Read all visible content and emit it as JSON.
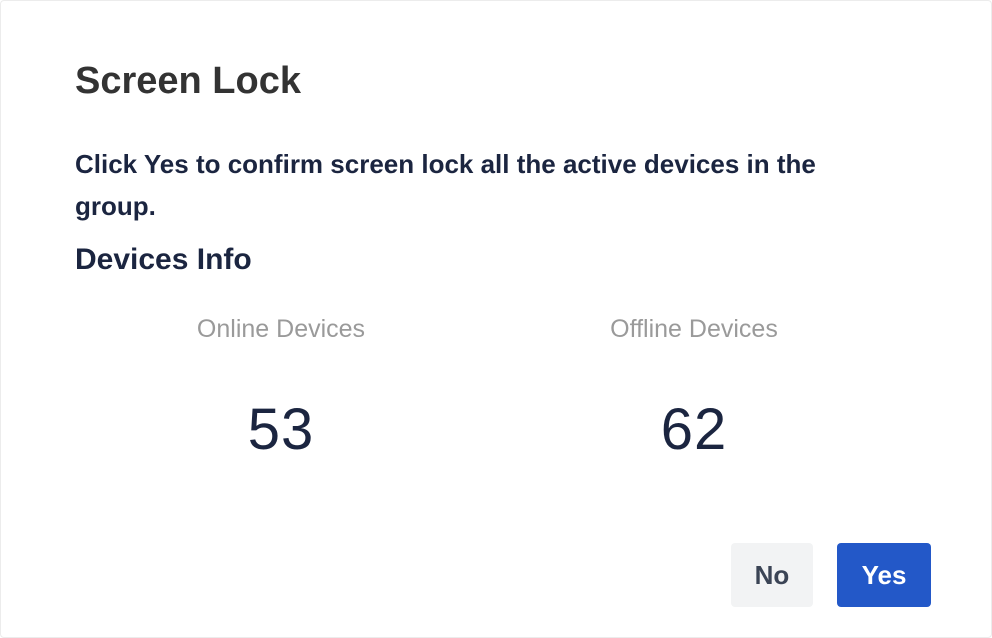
{
  "dialog": {
    "title": "Screen Lock",
    "message": "Click Yes to confirm screen lock all the active devices in the group.",
    "section_title": "Devices Info",
    "stats": {
      "online": {
        "label": "Online Devices",
        "value": "53"
      },
      "offline": {
        "label": "Offline Devices",
        "value": "62"
      }
    },
    "buttons": {
      "no_label": "No",
      "yes_label": "Yes"
    }
  },
  "colors": {
    "primary": "#2358c8",
    "heading": "#333333",
    "text_dark": "#1b2540",
    "text_muted": "#9a9a9a",
    "secondary_button_bg": "#f2f3f4"
  }
}
